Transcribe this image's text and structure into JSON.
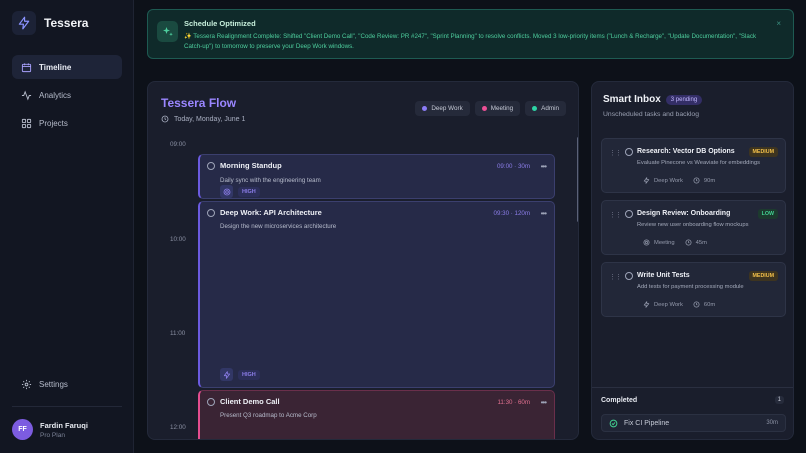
{
  "app": {
    "name": "Tessera"
  },
  "sidebar": {
    "items": [
      {
        "label": "Timeline",
        "icon": "calendar-icon",
        "active": true
      },
      {
        "label": "Analytics",
        "icon": "activity-icon",
        "active": false
      },
      {
        "label": "Projects",
        "icon": "grid-icon",
        "active": false
      }
    ],
    "settings_label": "Settings",
    "user": {
      "initials": "FF",
      "name": "Fardin Faruqi",
      "plan": "Pro Plan"
    }
  },
  "toast": {
    "icon": "sparkles-icon",
    "title": "Schedule Optimized",
    "message": "✨ Tessera Realignment Complete: Shifted \"Client Demo Call\", \"Code Review: PR #247\", \"Sprint Planning\" to resolve conflicts. Moved 3 low-priority items (\"Lunch & Recharge\", \"Update Documentation\", \"Slack Catch-up\") to tomorrow to preserve your Deep Work windows.",
    "close": "×"
  },
  "timeline": {
    "title": "Tessera Flow",
    "date": "Today, Monday, June 1",
    "legend": [
      {
        "label": "Deep Work",
        "color": "#8b7cf6"
      },
      {
        "label": "Meeting",
        "color": "#ec4f95"
      },
      {
        "label": "Admin",
        "color": "#2dd4a5"
      }
    ],
    "hours": [
      "09:00",
      "10:00",
      "11:00",
      "12:00"
    ],
    "events": [
      {
        "title": "Morning Standup",
        "description": "Daily sync with the engineering team",
        "time": "09:00 · 30m",
        "priority": "HIGH",
        "type": "deep-work"
      },
      {
        "title": "Deep Work: API Architecture",
        "description": "Design the new microservices architecture",
        "time": "09:30 · 120m",
        "priority": "HIGH",
        "type": "deep-work"
      },
      {
        "title": "Client Demo Call",
        "description": "Present Q3 roadmap to Acme Corp",
        "time": "11:30 · 60m",
        "type": "meeting"
      }
    ]
  },
  "inbox": {
    "title": "Smart Inbox",
    "badge": "3 pending",
    "subtitle": "Unscheduled tasks and backlog",
    "tasks": [
      {
        "title": "Research: Vector DB Options",
        "description": "Evaluate Pinecone vs Weaviate for embeddings",
        "priority": "MEDIUM",
        "category": "Deep Work",
        "duration": "90m"
      },
      {
        "title": "Design Review: Onboarding",
        "description": "Review new user onboarding flow mockups",
        "priority": "LOW",
        "category": "Meeting",
        "duration": "45m"
      },
      {
        "title": "Write Unit Tests",
        "description": "Add tests for payment processing module",
        "priority": "MEDIUM",
        "category": "Deep Work",
        "duration": "60m"
      }
    ],
    "completed": {
      "title": "Completed",
      "count": "1",
      "items": [
        {
          "title": "Fix CI Pipeline",
          "duration": "30m"
        }
      ]
    }
  }
}
